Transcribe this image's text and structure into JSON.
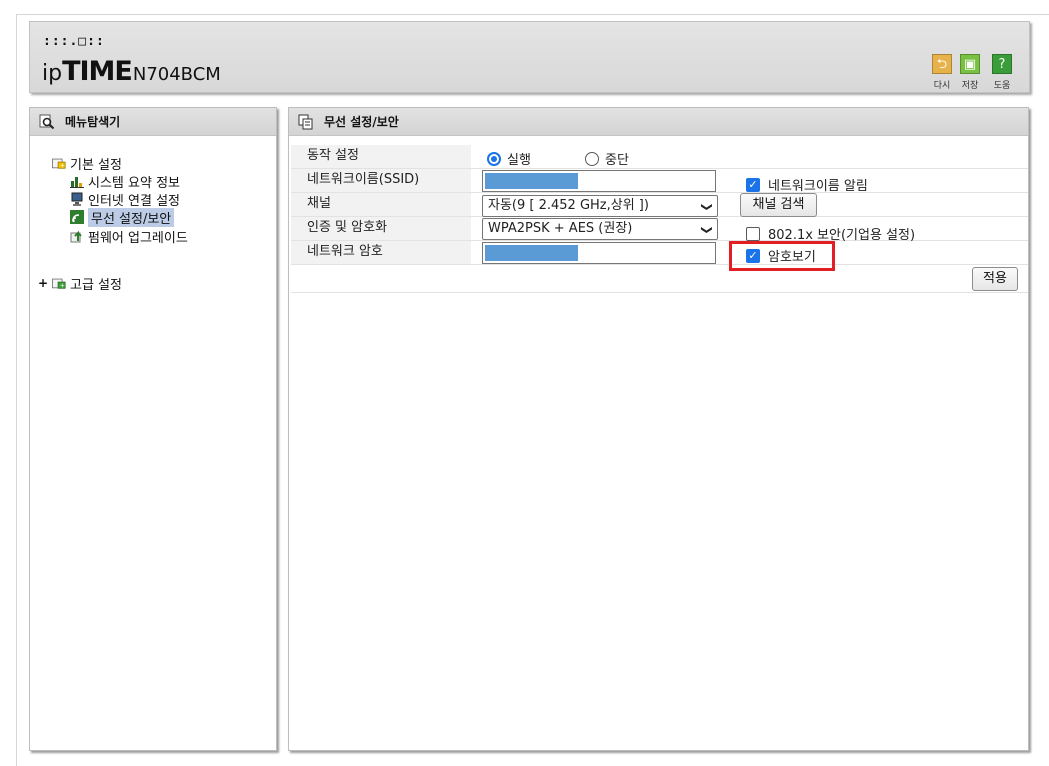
{
  "header": {
    "logo_dots": ":::.□::",
    "logo_ip": "ip",
    "logo_time": "TIME",
    "logo_model": "N704BCM",
    "tools": [
      {
        "label": "다시",
        "icon": "undo-icon",
        "color": "#e8b24a"
      },
      {
        "label": "저장",
        "icon": "save-icon",
        "color": "#7ac143"
      },
      {
        "label": "도움",
        "icon": "help-icon",
        "color": "#3a9d3a"
      }
    ]
  },
  "sidebar": {
    "title": "메뉴탐색기",
    "groups": [
      {
        "label": "기본 설정",
        "items": [
          {
            "label": "시스템 요약 정보",
            "icon": "chart-icon"
          },
          {
            "label": "인터넷 연결 설정",
            "icon": "computer-icon"
          },
          {
            "label": "무선 설정/보안",
            "icon": "wireless-icon",
            "selected": true
          },
          {
            "label": "펌웨어 업그레이드",
            "icon": "upgrade-icon"
          }
        ]
      },
      {
        "label": "고급 설정",
        "expander": "+"
      }
    ]
  },
  "main": {
    "title": "무선 설정/보안",
    "rows": {
      "operation": {
        "label": "동작 설정",
        "options": [
          {
            "label": "실행",
            "checked": true
          },
          {
            "label": "중단",
            "checked": false
          }
        ]
      },
      "ssid": {
        "label": "네트워크이름(SSID)",
        "value": "",
        "broadcast": {
          "label": "네트워크이름 알림",
          "checked": true
        }
      },
      "channel": {
        "label": "채널",
        "selected": "자동(9 [ 2.452 GHz,상위 ])",
        "scan_button": "채널 검색"
      },
      "auth": {
        "label": "인증 및 암호화",
        "selected": "WPA2PSK + AES (권장)",
        "dot1x": {
          "label": "802.1x 보안(기업용 설정)",
          "checked": false
        }
      },
      "password": {
        "label": "네트워크 암호",
        "value": "",
        "show": {
          "label": "암호보기",
          "checked": true
        }
      }
    },
    "apply_button": "적용"
  },
  "colors": {
    "accent": "#1a73e8",
    "highlight": "#e31e24",
    "masked_value": "#5b9bd5",
    "selected_menu": "#bccce6"
  }
}
